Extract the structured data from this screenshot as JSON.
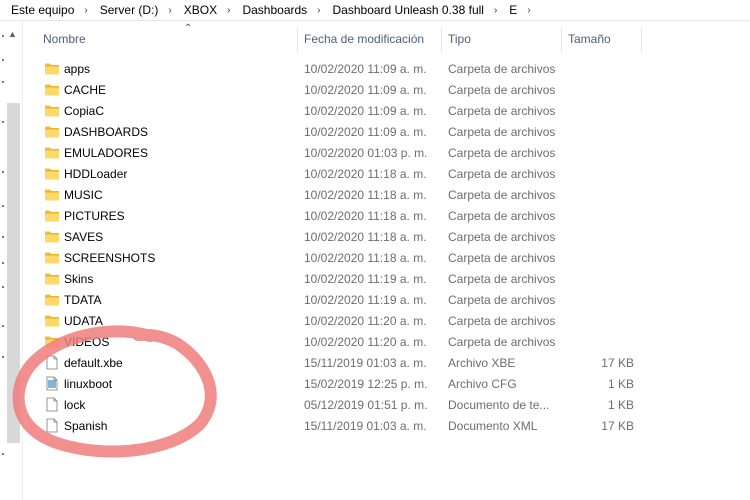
{
  "breadcrumb": [
    "Este equipo",
    "Server (D:)",
    "XBOX",
    "Dashboards",
    "Dashboard Unleash 0.38 full",
    "E"
  ],
  "columns": {
    "name": "Nombre",
    "date": "Fecha de modificación",
    "type": "Tipo",
    "size": "Tamaño"
  },
  "files": [
    {
      "name": "apps",
      "date": "10/02/2020 11:09 a. m.",
      "type": "Carpeta de archivos",
      "size": "",
      "icon": "folder-icon"
    },
    {
      "name": "CACHE",
      "date": "10/02/2020 11:09 a. m.",
      "type": "Carpeta de archivos",
      "size": "",
      "icon": "folder-icon"
    },
    {
      "name": "CopiaC",
      "date": "10/02/2020 11:09 a. m.",
      "type": "Carpeta de archivos",
      "size": "",
      "icon": "folder-icon"
    },
    {
      "name": "DASHBOARDS",
      "date": "10/02/2020 11:09 a. m.",
      "type": "Carpeta de archivos",
      "size": "",
      "icon": "folder-icon"
    },
    {
      "name": "EMULADORES",
      "date": "10/02/2020 01:03 p. m.",
      "type": "Carpeta de archivos",
      "size": "",
      "icon": "folder-icon"
    },
    {
      "name": "HDDLoader",
      "date": "10/02/2020 11:18 a. m.",
      "type": "Carpeta de archivos",
      "size": "",
      "icon": "folder-icon"
    },
    {
      "name": "MUSIC",
      "date": "10/02/2020 11:18 a. m.",
      "type": "Carpeta de archivos",
      "size": "",
      "icon": "folder-icon"
    },
    {
      "name": "PICTURES",
      "date": "10/02/2020 11:18 a. m.",
      "type": "Carpeta de archivos",
      "size": "",
      "icon": "folder-icon"
    },
    {
      "name": "SAVES",
      "date": "10/02/2020 11:18 a. m.",
      "type": "Carpeta de archivos",
      "size": "",
      "icon": "folder-icon"
    },
    {
      "name": "SCREENSHOTS",
      "date": "10/02/2020 11:18 a. m.",
      "type": "Carpeta de archivos",
      "size": "",
      "icon": "folder-icon"
    },
    {
      "name": "Skins",
      "date": "10/02/2020 11:19 a. m.",
      "type": "Carpeta de archivos",
      "size": "",
      "icon": "folder-icon"
    },
    {
      "name": "TDATA",
      "date": "10/02/2020 11:19 a. m.",
      "type": "Carpeta de archivos",
      "size": "",
      "icon": "folder-icon"
    },
    {
      "name": "UDATA",
      "date": "10/02/2020 11:20 a. m.",
      "type": "Carpeta de archivos",
      "size": "",
      "icon": "folder-icon"
    },
    {
      "name": "VIDEOS",
      "date": "10/02/2020 11:20 a. m.",
      "type": "Carpeta de archivos",
      "size": "",
      "icon": "folder-icon"
    },
    {
      "name": "default.xbe",
      "date": "15/11/2019 01:03 a. m.",
      "type": "Archivo XBE",
      "size": "17 KB",
      "icon": "file-icon"
    },
    {
      "name": "linuxboot",
      "date": "15/02/2019 12:25 p. m.",
      "type": "Archivo CFG",
      "size": "1 KB",
      "icon": "config-file-icon"
    },
    {
      "name": "lock",
      "date": "05/12/2019 01:51 p. m.",
      "type": "Documento de te...",
      "size": "1 KB",
      "icon": "file-icon"
    },
    {
      "name": "Spanish",
      "date": "15/11/2019 01:03 a. m.",
      "type": "Documento XML",
      "size": "17 KB",
      "icon": "file-icon"
    }
  ],
  "annotation_color": "#f07b7b"
}
